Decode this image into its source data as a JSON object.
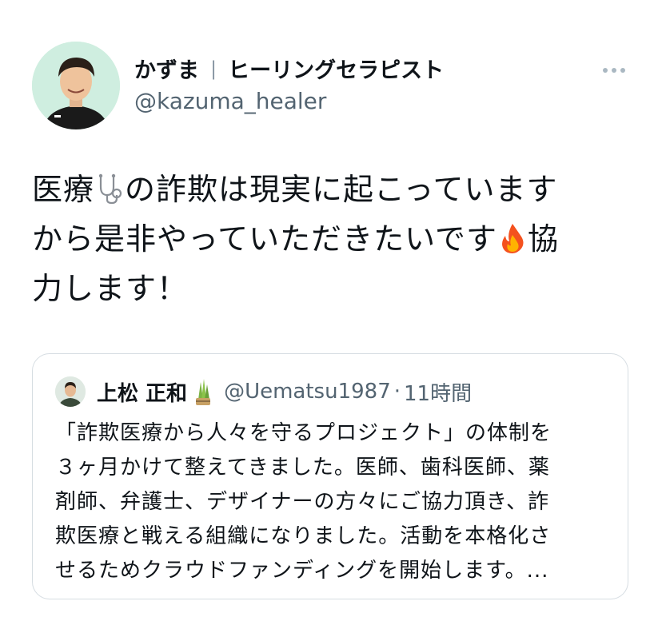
{
  "tweet": {
    "display_name": "かずま",
    "separator": "|",
    "bio_title": "ヒーリングセラピスト",
    "handle": "@kazuma_healer",
    "text_part1": "医療",
    "text_part2": "の詐欺は現実に起こっています",
    "text_part3": "から是非やっていただきたいです",
    "text_part4": "協",
    "text_part5": "力します！",
    "emojis": [
      "stethoscope-icon",
      "fire-icon"
    ]
  },
  "quote": {
    "display_name": "上松 正和",
    "name_emoji": "kadomatsu-icon",
    "handle": "@Uematsu1987",
    "dot": "·",
    "time": "11時間",
    "lines": [
      "「詐欺医療から人々を守るプロジェクト」の体制を",
      "３ヶ月かけて整えてきました。医師、歯科医師、薬",
      "剤師、弁護士、デザイナーの方々にご協力頂き、詐",
      "欺医療と戦える組織になりました。活動を本格化さ",
      "せるためクラウドファンディングを開始します。..."
    ]
  },
  "colors": {
    "text": "#0f1419",
    "secondary": "#536471",
    "border": "#d6dde2",
    "avatar_bg": "#cfeee0"
  }
}
